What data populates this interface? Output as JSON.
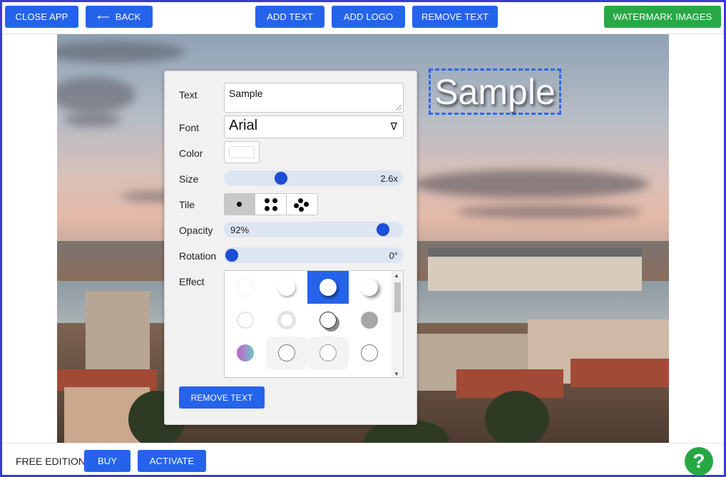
{
  "toolbar": {
    "close_app": "CLOSE APP",
    "back": "BACK",
    "back_icon": "back-arrow-icon",
    "add_text": "ADD TEXT",
    "add_logo": "ADD LOGO",
    "remove_text": "REMOVE TEXT",
    "watermark_images": "WATERMARK IMAGES"
  },
  "canvas": {
    "watermark_text": "Sample"
  },
  "panel": {
    "text_label": "Text",
    "text_value": "Sample",
    "font_label": "Font",
    "font_value": "Arial",
    "font_arrow": "∇",
    "color_label": "Color",
    "color_value": "#ffffff",
    "size_label": "Size",
    "size_value": "2.6x",
    "size_fraction": 0.3,
    "tile_label": "Tile",
    "tile_options": [
      "single-dot-icon",
      "four-dots-icon",
      "five-dots-icon"
    ],
    "opacity_label": "Opacity",
    "opacity_value": "92%",
    "opacity_fraction": 0.92,
    "rotation_label": "Rotation",
    "rotation_value": "0°",
    "rotation_fraction": 0.0,
    "effect_label": "Effect",
    "remove_text_button": "REMOVE TEXT"
  },
  "footer": {
    "edition": "FREE EDITION",
    "buy": "BUY",
    "activate": "ACTIVATE",
    "help": "?"
  },
  "colors": {
    "primary": "#2563eb",
    "success": "#28a745",
    "frame": "#3b3bd1"
  }
}
